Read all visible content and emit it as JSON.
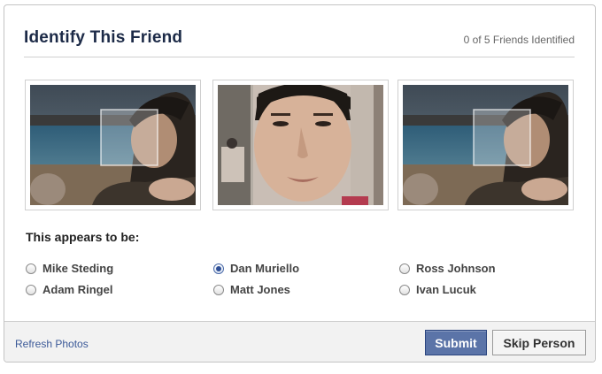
{
  "dialog": {
    "title": "Identify This Friend",
    "counter": "0 of 5 Friends Identified"
  },
  "photos": [
    {
      "description_icon": "beach-photo-zoomed-out"
    },
    {
      "description_icon": "face-closeup-photo"
    },
    {
      "description_icon": "beach-photo-zoomed-out"
    }
  ],
  "question": "This appears to be:",
  "options": [
    {
      "label": "Mike Steding",
      "checked": false
    },
    {
      "label": "Adam Ringel",
      "checked": false
    },
    {
      "label": "Dan Muriello",
      "checked": true
    },
    {
      "label": "Matt Jones",
      "checked": false
    },
    {
      "label": "Ross Johnson",
      "checked": false
    },
    {
      "label": "Ivan Lucuk",
      "checked": false
    }
  ],
  "footer": {
    "refresh_label": "Refresh Photos",
    "submit_label": "Submit",
    "skip_label": "Skip Person"
  },
  "colors": {
    "title": "#1c2a47",
    "link": "#3b5998",
    "submit_bg": "#5b74a8"
  }
}
